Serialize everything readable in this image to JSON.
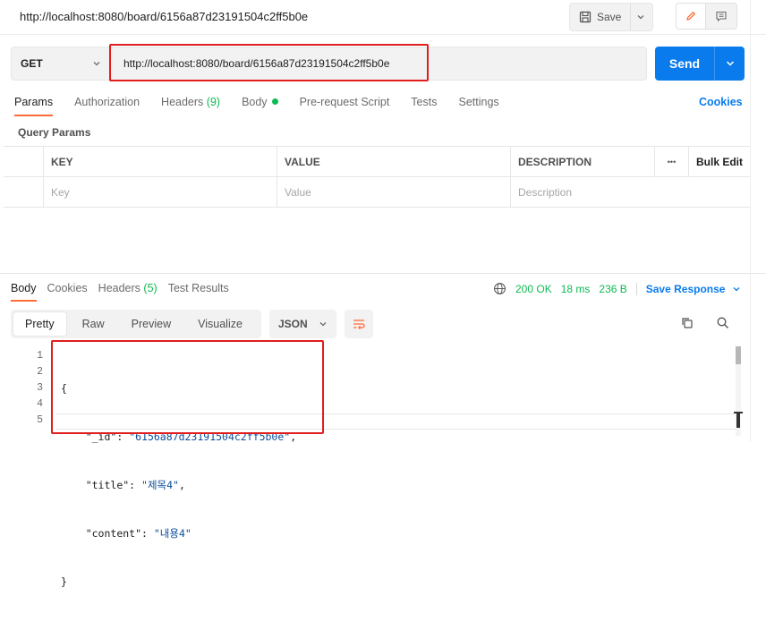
{
  "tab": {
    "title": "http://localhost:8080/board/6156a87d23191504c2ff5b0e"
  },
  "toolbar": {
    "save_label": "Save"
  },
  "request": {
    "method": "GET",
    "url": "http://localhost:8080/board/6156a87d23191504c2ff5b0e",
    "send_label": "Send"
  },
  "request_tabs": {
    "params": "Params",
    "authorization": "Authorization",
    "headers": "Headers",
    "headers_count": "(9)",
    "body": "Body",
    "prerequest": "Pre-request Script",
    "tests": "Tests",
    "settings": "Settings",
    "cookies": "Cookies"
  },
  "query_params": {
    "title": "Query Params",
    "columns": {
      "key": "KEY",
      "value": "VALUE",
      "description": "DESCRIPTION",
      "more": "•••",
      "bulk_edit": "Bulk Edit"
    },
    "placeholders": {
      "key": "Key",
      "value": "Value",
      "description": "Description"
    }
  },
  "response_tabs": {
    "body": "Body",
    "cookies": "Cookies",
    "headers": "Headers",
    "headers_count": "(5)",
    "test_results": "Test Results"
  },
  "status": {
    "code": "200 OK",
    "time": "18 ms",
    "size": "236 B",
    "save_response": "Save Response"
  },
  "view_modes": {
    "pretty": "Pretty",
    "raw": "Raw",
    "preview": "Preview",
    "visualize": "Visualize"
  },
  "format": "JSON",
  "response_body": {
    "line_numbers": [
      "1",
      "2",
      "3",
      "4",
      "5"
    ],
    "open_brace": "{",
    "close_brace": "}",
    "fields": [
      {
        "key": "\"_id\"",
        "value": "\"6156a87d23191504c2ff5b0e\"",
        "trail": ","
      },
      {
        "key": "\"title\"",
        "value": "\"제목4\"",
        "trail": ","
      },
      {
        "key": "\"content\"",
        "value": "\"내용4\"",
        "trail": ""
      }
    ]
  },
  "colors": {
    "accent": "#ff6c37",
    "send": "#097bed",
    "success": "#0cbb52",
    "highlight": "#e01e1e"
  }
}
